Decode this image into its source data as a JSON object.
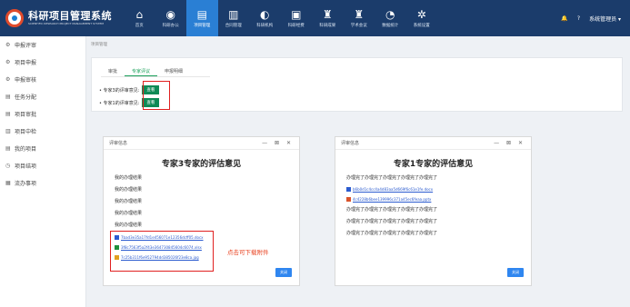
{
  "app": {
    "title": "科研项目管理系统",
    "subtitle": "SCIENTIFIC RESEARCH PROJECT MANAGEMENT SYSTEM"
  },
  "nav": [
    {
      "label": "首页",
      "icon": "home-icon",
      "glyph": "⌂"
    },
    {
      "label": "科研办公",
      "icon": "office-icon",
      "glyph": "◉"
    },
    {
      "label": "项目管理",
      "icon": "project-icon",
      "glyph": "▤",
      "active": true
    },
    {
      "label": "合同管理",
      "icon": "contract-icon",
      "glyph": "▥"
    },
    {
      "label": "科研机构",
      "icon": "institution-icon",
      "glyph": "◐"
    },
    {
      "label": "科研经费",
      "icon": "funding-icon",
      "glyph": "▣"
    },
    {
      "label": "科研成果",
      "icon": "trophy-icon",
      "glyph": "♜"
    },
    {
      "label": "学术会议",
      "icon": "conference-icon",
      "glyph": "♜"
    },
    {
      "label": "数据统计",
      "icon": "chart-icon",
      "glyph": "◔"
    },
    {
      "label": "系统设置",
      "icon": "gear-icon",
      "glyph": "✲"
    }
  ],
  "topright": {
    "bell": "🔔",
    "help": "?",
    "user": "系统管理员 ▾"
  },
  "sidebar": [
    {
      "label": "申报评审",
      "icon": "gear-icon",
      "glyph": "⚙"
    },
    {
      "label": "项目申报",
      "icon": "gear-icon",
      "glyph": "⚙"
    },
    {
      "label": "申报审核",
      "icon": "gear-icon",
      "glyph": "⚙"
    },
    {
      "label": "任务分配",
      "icon": "task-icon",
      "glyph": "▤"
    },
    {
      "label": "项目审批",
      "icon": "list-icon",
      "glyph": "▤"
    },
    {
      "label": "项目中检",
      "icon": "chart-icon",
      "glyph": "▥"
    },
    {
      "label": "我的项目",
      "icon": "doc-icon",
      "glyph": "▤"
    },
    {
      "label": "项目结项",
      "icon": "clock-icon",
      "glyph": "◷"
    },
    {
      "label": "流办事项",
      "icon": "grid-icon",
      "glyph": "▦"
    }
  ],
  "breadcrumb": "项目管理",
  "tabs": [
    {
      "label": "审批"
    },
    {
      "label": "专家评议",
      "active": true
    },
    {
      "label": "申报明细"
    }
  ],
  "opinions": [
    {
      "label": "• 专家3的评审意见:",
      "button": "查看"
    },
    {
      "label": "• 专家1的评审意见:",
      "button": "查看"
    }
  ],
  "dialog_left": {
    "header": "评审信息",
    "controls": "— ⊠ ✕",
    "title": "专家3专家的评估意见",
    "lines": [
      "我的办理结果",
      "我的办理结果",
      "我的办理结果",
      "我的办理结果",
      "我的办理结果"
    ],
    "files": [
      {
        "name": "7bad3e35a17fd1e456071e12356dcff05.docx",
        "type": "word",
        "color": "#2b5bcf"
      },
      {
        "name": "3f8c7563f5a2f43e364730845604c6074.xlsx",
        "type": "excel",
        "color": "#1f8f3a"
      },
      {
        "name": "7c25b311f6e952794dd385026f23e8ca.jpg",
        "type": "image",
        "color": "#e0a020"
      }
    ],
    "close": "关闭"
  },
  "annotation": "点击可下载附件",
  "dialog_right": {
    "header": "评审信息",
    "controls": "— ⊠ ✕",
    "title": "专家1专家的评估意见",
    "lines_top": [
      "办理完了办理完了办理完了办理完了办理完了"
    ],
    "files": [
      {
        "name": "b6b0d1c4cc4a4d83aa5d669f6c61e1fe.docx",
        "type": "word",
        "color": "#2b5bcf"
      },
      {
        "name": "4c4228b6bee139996c371a45ec6feaa.pptx",
        "type": "ppt",
        "color": "#d9532b"
      }
    ],
    "lines_bottom": [
      "办理完了办理完了办理完了办理完了办理完了",
      "办理完了办理完了办理完了办理完了办理完了",
      "办理完了办理完了办理完了办理完了办理完了"
    ],
    "close": "关闭"
  }
}
